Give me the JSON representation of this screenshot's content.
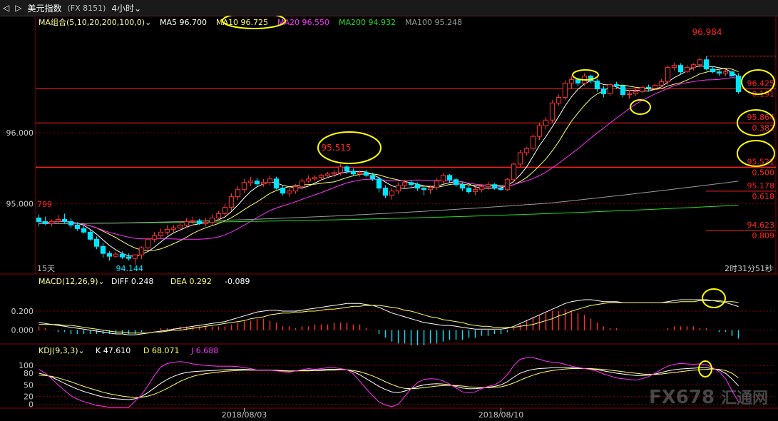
{
  "topbar": {
    "nav_back": "◁",
    "nav_fwd": "▷",
    "symbol_name": "美元指数",
    "symbol_code": "(FX 8151)",
    "period": "4小时",
    "period_caret": "⌄"
  },
  "watermark": {
    "brand": "FX678",
    "tag": "汇通网"
  },
  "colors": {
    "up": "#ff3232",
    "down": "#00e5ff",
    "ma5": "#ffffff",
    "ma10": "#ffff66",
    "ma20": "#ff33ff",
    "ma200": "#22dd22",
    "ma100": "#999999",
    "fib": "#ff2222",
    "highlight": "#ffff00",
    "grid": "#8b0000"
  },
  "chart_data": [
    {
      "type": "candlestick",
      "panel": "price",
      "legend": {
        "label": "MA组合(5,10,20,200,100,0)",
        "items": [
          {
            "name": "MA5",
            "value": "96.700"
          },
          {
            "name": "MA10",
            "value": "96.725"
          },
          {
            "name": "MA20",
            "value": "96.550"
          },
          {
            "name": "MA200",
            "value": "94.932"
          },
          {
            "name": "MA100",
            "value": "95.248"
          }
        ]
      },
      "ylim": [
        94.0,
        97.45
      ],
      "y_ticks": [
        "96.000",
        "95.000"
      ],
      "y_tick_values": [
        96.0,
        95.0
      ],
      "x_labels": [
        "2018/08/03",
        "2018/08/10"
      ],
      "x_label_index": [
        32,
        72
      ],
      "period_label": "15天",
      "countdown": "2时31分51秒",
      "annotations": {
        "high_value": "96.984",
        "high_index": 104,
        "low_value": "94.144",
        "low_index": 14,
        "left_value": "799",
        "mid_peak_value": "95.515",
        "mid_peak_index": 48
      },
      "fib_levels": [
        {
          "price": 96.62,
          "price_label": "96.425",
          "ratio_label": "0.191"
        },
        {
          "price": 96.14,
          "price_label": "95.864",
          "ratio_label": "0.382"
        },
        {
          "price": 95.515,
          "price_label": "95.521",
          "ratio_label": "0.500"
        },
        {
          "price": 95.178,
          "price_label": "95.178",
          "ratio_label": "0.618"
        },
        {
          "price": 94.623,
          "price_label": "94.623",
          "ratio_label": "0.809"
        }
      ],
      "candles": {
        "o": [
          94.8,
          94.75,
          94.72,
          94.75,
          94.78,
          94.75,
          94.7,
          94.65,
          94.6,
          94.5,
          94.4,
          94.3,
          94.26,
          94.29,
          94.25,
          94.23,
          94.28,
          94.38,
          94.5,
          94.55,
          94.6,
          94.64,
          94.66,
          94.7,
          94.75,
          94.76,
          94.72,
          94.74,
          94.8,
          94.86,
          94.95,
          95.1,
          95.2,
          95.3,
          95.32,
          95.28,
          95.3,
          95.35,
          95.22,
          95.15,
          95.18,
          95.24,
          95.32,
          95.35,
          95.37,
          95.4,
          95.42,
          95.44,
          95.52,
          95.46,
          95.42,
          95.44,
          95.4,
          95.35,
          95.22,
          95.12,
          95.18,
          95.26,
          95.3,
          95.27,
          95.22,
          95.2,
          95.23,
          95.32,
          95.4,
          95.34,
          95.27,
          95.22,
          95.17,
          95.2,
          95.24,
          95.27,
          95.22,
          95.2,
          95.34,
          95.56,
          95.72,
          95.78,
          95.95,
          96.1,
          96.18,
          96.42,
          96.5,
          96.7,
          96.75,
          96.7,
          96.8,
          96.73,
          96.62,
          96.55,
          96.68,
          96.66,
          96.54,
          96.55,
          96.58,
          96.64,
          96.63,
          96.67,
          96.72,
          96.92,
          96.95,
          96.86,
          96.92,
          96.96,
          97.03,
          96.9,
          96.86,
          96.84,
          96.86,
          96.8
        ],
        "h": [
          94.85,
          94.82,
          94.78,
          94.84,
          94.86,
          94.8,
          94.74,
          94.7,
          94.64,
          94.54,
          94.45,
          94.33,
          94.32,
          94.33,
          94.3,
          94.28,
          94.4,
          94.52,
          94.6,
          94.65,
          94.7,
          94.7,
          94.75,
          94.8,
          94.82,
          94.79,
          94.8,
          94.85,
          94.9,
          95.0,
          95.15,
          95.25,
          95.35,
          95.38,
          95.36,
          95.35,
          95.4,
          95.38,
          95.26,
          95.22,
          95.28,
          95.36,
          95.4,
          95.4,
          95.42,
          95.45,
          95.48,
          95.56,
          95.55,
          95.5,
          95.47,
          95.48,
          95.44,
          95.38,
          95.26,
          95.22,
          95.3,
          95.34,
          95.33,
          95.3,
          95.26,
          95.26,
          95.36,
          95.44,
          95.42,
          95.37,
          95.3,
          95.25,
          95.24,
          95.28,
          95.31,
          95.29,
          95.25,
          95.36,
          95.58,
          95.76,
          95.8,
          95.98,
          96.14,
          96.22,
          96.46,
          96.54,
          96.74,
          96.8,
          96.76,
          96.84,
          96.82,
          96.76,
          96.66,
          96.7,
          96.72,
          96.68,
          96.6,
          96.62,
          96.66,
          96.68,
          96.7,
          96.76,
          96.95,
          96.99,
          96.98,
          96.96,
          96.98,
          97.06,
          97.08,
          96.94,
          96.9,
          96.9,
          96.88,
          96.84
        ],
        "l": [
          94.68,
          94.7,
          94.68,
          94.72,
          94.72,
          94.66,
          94.62,
          94.58,
          94.48,
          94.36,
          94.24,
          94.2,
          94.24,
          94.22,
          94.2,
          94.14,
          94.22,
          94.34,
          94.46,
          94.52,
          94.56,
          94.6,
          94.62,
          94.66,
          94.7,
          94.7,
          94.68,
          94.7,
          94.76,
          94.82,
          94.9,
          95.05,
          95.15,
          95.25,
          95.24,
          95.24,
          95.26,
          95.2,
          95.12,
          95.1,
          95.14,
          95.2,
          95.3,
          95.32,
          95.33,
          95.36,
          95.38,
          95.4,
          95.42,
          95.4,
          95.38,
          95.38,
          95.32,
          95.16,
          95.08,
          95.06,
          95.14,
          95.22,
          95.24,
          95.18,
          95.12,
          95.14,
          95.2,
          95.28,
          95.3,
          95.24,
          95.18,
          95.14,
          95.12,
          95.16,
          95.2,
          95.2,
          95.18,
          95.18,
          95.3,
          95.52,
          95.68,
          95.74,
          95.9,
          96.05,
          96.14,
          96.38,
          96.46,
          96.62,
          96.66,
          96.66,
          96.7,
          96.58,
          96.5,
          96.52,
          96.62,
          96.5,
          96.48,
          96.52,
          96.56,
          96.58,
          96.6,
          96.64,
          96.68,
          96.88,
          96.82,
          96.84,
          96.88,
          96.92,
          96.88,
          96.84,
          96.8,
          96.8,
          96.8,
          96.55
        ],
        "c": [
          94.75,
          94.72,
          94.75,
          94.78,
          94.75,
          94.7,
          94.65,
          94.6,
          94.5,
          94.4,
          94.3,
          94.26,
          94.29,
          94.25,
          94.23,
          94.28,
          94.38,
          94.5,
          94.55,
          94.6,
          94.64,
          94.66,
          94.7,
          94.75,
          94.76,
          94.72,
          94.74,
          94.8,
          94.86,
          94.95,
          95.1,
          95.2,
          95.3,
          95.32,
          95.28,
          95.3,
          95.35,
          95.22,
          95.15,
          95.18,
          95.24,
          95.32,
          95.35,
          95.37,
          95.4,
          95.42,
          95.44,
          95.52,
          95.46,
          95.42,
          95.44,
          95.4,
          95.35,
          95.22,
          95.12,
          95.18,
          95.26,
          95.3,
          95.27,
          95.22,
          95.2,
          95.23,
          95.32,
          95.4,
          95.34,
          95.27,
          95.22,
          95.17,
          95.2,
          95.24,
          95.27,
          95.22,
          95.2,
          95.34,
          95.56,
          95.72,
          95.78,
          95.95,
          96.1,
          96.18,
          96.42,
          96.5,
          96.7,
          96.75,
          96.7,
          96.8,
          96.73,
          96.62,
          96.55,
          96.68,
          96.66,
          96.54,
          96.55,
          96.58,
          96.64,
          96.63,
          96.67,
          96.72,
          96.92,
          96.95,
          96.86,
          96.92,
          96.96,
          97.03,
          96.9,
          96.86,
          96.84,
          96.86,
          96.8,
          96.58
        ]
      }
    },
    {
      "type": "bar",
      "panel": "macd",
      "legend": {
        "label": "MACD(12,26,9)",
        "items": [
          {
            "name": "DIFF",
            "value": "0.248"
          },
          {
            "name": "DEA",
            "value": "0.292"
          },
          {
            "name": "",
            "value": "-0.089"
          }
        ]
      },
      "ylim": [
        -0.16,
        0.38
      ],
      "y_ticks": [
        "0.200",
        "0.000"
      ],
      "y_tick_values": [
        0.2,
        0.0
      ],
      "diff": [
        0.08,
        0.07,
        0.06,
        0.05,
        0.04,
        0.03,
        0.02,
        0.01,
        0.0,
        -0.01,
        -0.02,
        -0.03,
        -0.04,
        -0.04,
        -0.05,
        -0.05,
        -0.04,
        -0.03,
        -0.02,
        -0.01,
        0.0,
        0.01,
        0.02,
        0.03,
        0.04,
        0.05,
        0.06,
        0.07,
        0.08,
        0.09,
        0.11,
        0.13,
        0.15,
        0.17,
        0.19,
        0.2,
        0.21,
        0.21,
        0.2,
        0.2,
        0.2,
        0.21,
        0.22,
        0.23,
        0.24,
        0.25,
        0.26,
        0.27,
        0.28,
        0.28,
        0.28,
        0.27,
        0.26,
        0.24,
        0.21,
        0.18,
        0.16,
        0.14,
        0.12,
        0.1,
        0.08,
        0.07,
        0.06,
        0.05,
        0.05,
        0.04,
        0.03,
        0.02,
        0.01,
        0.01,
        0.01,
        0.01,
        0.01,
        0.02,
        0.04,
        0.07,
        0.1,
        0.13,
        0.16,
        0.19,
        0.22,
        0.25,
        0.28,
        0.3,
        0.31,
        0.32,
        0.32,
        0.31,
        0.3,
        0.3,
        0.3,
        0.29,
        0.29,
        0.29,
        0.29,
        0.29,
        0.29,
        0.29,
        0.3,
        0.31,
        0.32,
        0.32,
        0.32,
        0.32,
        0.32,
        0.31,
        0.3,
        0.29,
        0.27,
        0.248
      ],
      "dea": [
        0.06,
        0.06,
        0.06,
        0.06,
        0.05,
        0.05,
        0.04,
        0.03,
        0.02,
        0.01,
        0.0,
        -0.01,
        -0.02,
        -0.02,
        -0.03,
        -0.03,
        -0.03,
        -0.03,
        -0.02,
        -0.02,
        -0.01,
        0.0,
        0.0,
        0.01,
        0.02,
        0.03,
        0.04,
        0.05,
        0.06,
        0.07,
        0.08,
        0.09,
        0.1,
        0.12,
        0.13,
        0.14,
        0.16,
        0.17,
        0.18,
        0.18,
        0.19,
        0.19,
        0.2,
        0.2,
        0.21,
        0.22,
        0.22,
        0.23,
        0.24,
        0.25,
        0.25,
        0.26,
        0.26,
        0.26,
        0.25,
        0.24,
        0.23,
        0.21,
        0.2,
        0.18,
        0.16,
        0.14,
        0.13,
        0.11,
        0.1,
        0.09,
        0.08,
        0.06,
        0.05,
        0.04,
        0.04,
        0.03,
        0.03,
        0.03,
        0.03,
        0.04,
        0.05,
        0.06,
        0.08,
        0.1,
        0.12,
        0.15,
        0.17,
        0.2,
        0.22,
        0.24,
        0.26,
        0.27,
        0.28,
        0.29,
        0.29,
        0.29,
        0.29,
        0.29,
        0.29,
        0.29,
        0.29,
        0.29,
        0.29,
        0.29,
        0.3,
        0.3,
        0.3,
        0.31,
        0.31,
        0.31,
        0.31,
        0.3,
        0.3,
        0.292
      ]
    },
    {
      "type": "line",
      "panel": "kdj",
      "legend": {
        "label": "KDJ(9,3,3)",
        "items": [
          {
            "name": "K",
            "value": "47.610"
          },
          {
            "name": "D",
            "value": "68.071"
          },
          {
            "name": "J",
            "value": "6.688"
          }
        ]
      },
      "ylim": [
        -10,
        115
      ],
      "y_ticks": [
        "100",
        "80",
        "50",
        "20",
        "0"
      ],
      "y_tick_values": [
        100,
        80,
        50,
        20,
        0
      ],
      "k": [
        80,
        76,
        70,
        62,
        54,
        46,
        39,
        33,
        28,
        23,
        19,
        16,
        14,
        13,
        12,
        14,
        20,
        30,
        42,
        54,
        64,
        72,
        78,
        82,
        84,
        85,
        86,
        87,
        88,
        89,
        90,
        90,
        90,
        89,
        88,
        88,
        88,
        87,
        86,
        85,
        86,
        87,
        88,
        88,
        89,
        90,
        90,
        90,
        89,
        84,
        76,
        66,
        56,
        46,
        38,
        32,
        30,
        34,
        40,
        46,
        50,
        52,
        53,
        52,
        50,
        46,
        42,
        40,
        40,
        42,
        44,
        46,
        50,
        58,
        70,
        80,
        86,
        90,
        92,
        93,
        94,
        95,
        95,
        94,
        93,
        92,
        91,
        89,
        86,
        83,
        80,
        78,
        76,
        74,
        74,
        75,
        78,
        82,
        86,
        89,
        91,
        92,
        93,
        94,
        94,
        92,
        88,
        80,
        65,
        47.61
      ],
      "d": [
        75,
        74,
        72,
        68,
        63,
        58,
        52,
        46,
        41,
        36,
        31,
        27,
        24,
        21,
        19,
        17,
        18,
        21,
        26,
        33,
        41,
        50,
        59,
        66,
        72,
        76,
        79,
        81,
        83,
        85,
        86,
        87,
        88,
        88,
        88,
        88,
        88,
        88,
        87,
        86,
        86,
        86,
        86,
        87,
        87,
        88,
        88,
        89,
        89,
        87,
        84,
        79,
        73,
        66,
        58,
        51,
        45,
        41,
        40,
        41,
        43,
        45,
        47,
        48,
        49,
        48,
        47,
        45,
        44,
        43,
        43,
        44,
        45,
        49,
        55,
        62,
        69,
        75,
        80,
        84,
        87,
        89,
        91,
        92,
        92,
        92,
        92,
        91,
        90,
        88,
        86,
        84,
        82,
        80,
        78,
        77,
        77,
        78,
        80,
        82,
        84,
        86,
        88,
        89,
        90,
        91,
        90,
        87,
        80,
        68.071
      ],
      "j": [
        90,
        80,
        66,
        50,
        36,
        22,
        13,
        7,
        2,
        -3,
        -5,
        -8,
        -8,
        -8,
        -8,
        8,
        24,
        48,
        74,
        96,
        105,
        108,
        110,
        108,
        104,
        102,
        100,
        99,
        98,
        98,
        98,
        97,
        94,
        92,
        88,
        88,
        88,
        86,
        84,
        82,
        86,
        89,
        92,
        90,
        92,
        94,
        94,
        92,
        89,
        78,
        60,
        40,
        22,
        6,
        -2,
        -6,
        0,
        20,
        40,
        56,
        64,
        66,
        65,
        60,
        52,
        42,
        32,
        30,
        32,
        40,
        46,
        50,
        60,
        76,
        100,
        116,
        120,
        120,
        116,
        111,
        108,
        107,
        103,
        98,
        95,
        92,
        89,
        85,
        78,
        73,
        68,
        66,
        64,
        62,
        66,
        71,
        80,
        90,
        98,
        103,
        105,
        104,
        103,
        104,
        102,
        94,
        84,
        66,
        35,
        6.688
      ]
    }
  ]
}
